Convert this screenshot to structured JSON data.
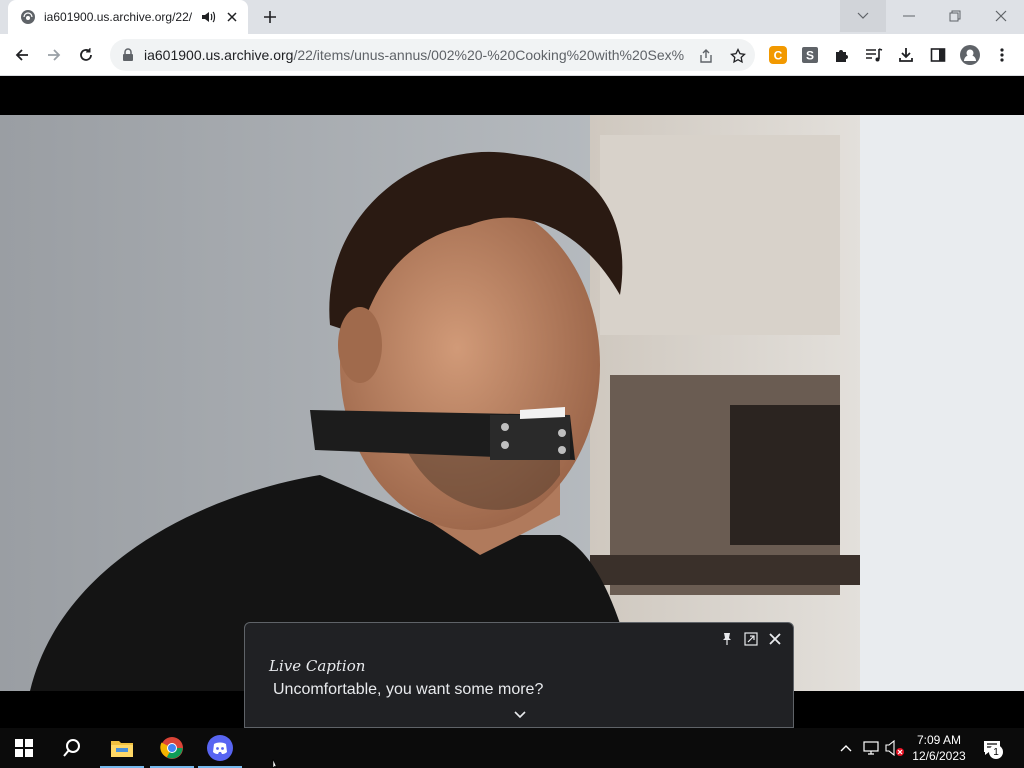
{
  "browser": {
    "tab_title": "ia601900.us.archive.org/22/",
    "url_host": "ia601900.us.archive.org",
    "url_path": "/22/items/unus-annus/002%20-%20Cooking%20with%20Sex%..."
  },
  "icons": {
    "tab_favicon": "globe-icon",
    "tab_audio": "speaker-icon",
    "tab_close": "close-icon",
    "new_tab": "plus-icon",
    "back": "arrow-left-icon",
    "forward": "arrow-right-icon",
    "reload": "reload-icon",
    "lock": "lock-icon",
    "share": "share-icon",
    "bookmark": "star-icon",
    "extensions": [
      "coupon-extension-icon",
      "s-extension-icon",
      "puzzle-icon",
      "media-control-icon",
      "download-icon",
      "side-panel-icon",
      "profile-icon",
      "menu-icon"
    ]
  },
  "colors": {
    "ext_orange": "#f29900",
    "discord": "#5865f2",
    "caption_bg": "#202124"
  },
  "live_caption": {
    "title": "Live Caption",
    "text": "Uncomfortable, you want some more?"
  },
  "taskbar": {
    "apps": [
      "start-icon",
      "search-icon",
      "file-explorer-icon",
      "chrome-icon",
      "discord-icon"
    ],
    "time": "7:09 AM",
    "date": "12/6/2023",
    "notifications": "1"
  }
}
